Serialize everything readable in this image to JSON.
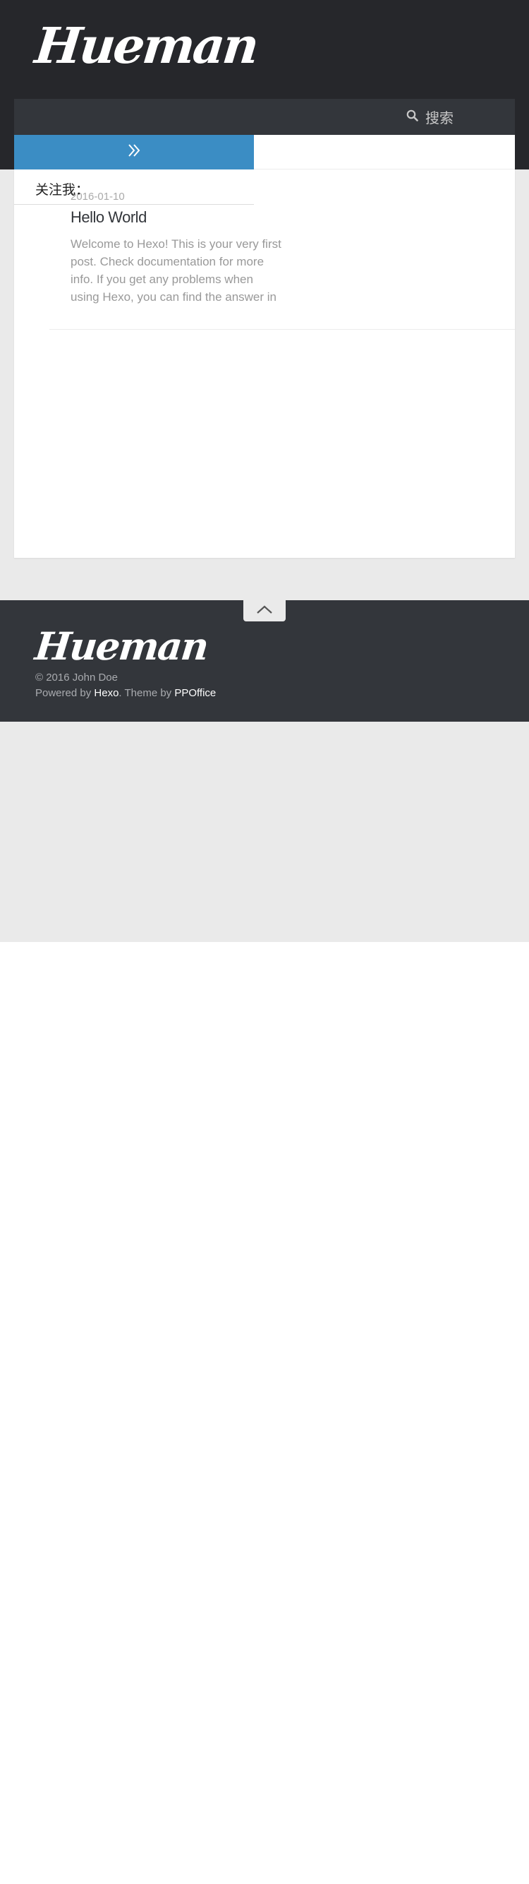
{
  "header": {
    "logo": "Hueman"
  },
  "navbar": {
    "search_label": "搜索",
    "search_icon": "search-icon"
  },
  "sidebar": {
    "toggle_icon": "double-chevron-right-icon",
    "follow_label": "关注我："
  },
  "post": {
    "date": "2016-01-10",
    "title": "Hello World",
    "excerpt": "Welcome to Hexo! This is your very first post. Check documentation for more info. If you get any problems when using Hexo, you can find the answer in"
  },
  "footer": {
    "back_to_top_icon": "chevron-up-icon",
    "logo": "Hueman",
    "copyright": "© 2016 John Doe",
    "powered_prefix": "Powered by",
    "powered_link": "Hexo",
    "theme_prefix": ". Theme by",
    "theme_link": "PPOffice"
  },
  "colors": {
    "header_bg": "#26272b",
    "navbar_bg": "#33363b",
    "accent": "#3b8dc4",
    "page_bg": "#eaeaea",
    "footer_bg": "#33363b"
  }
}
